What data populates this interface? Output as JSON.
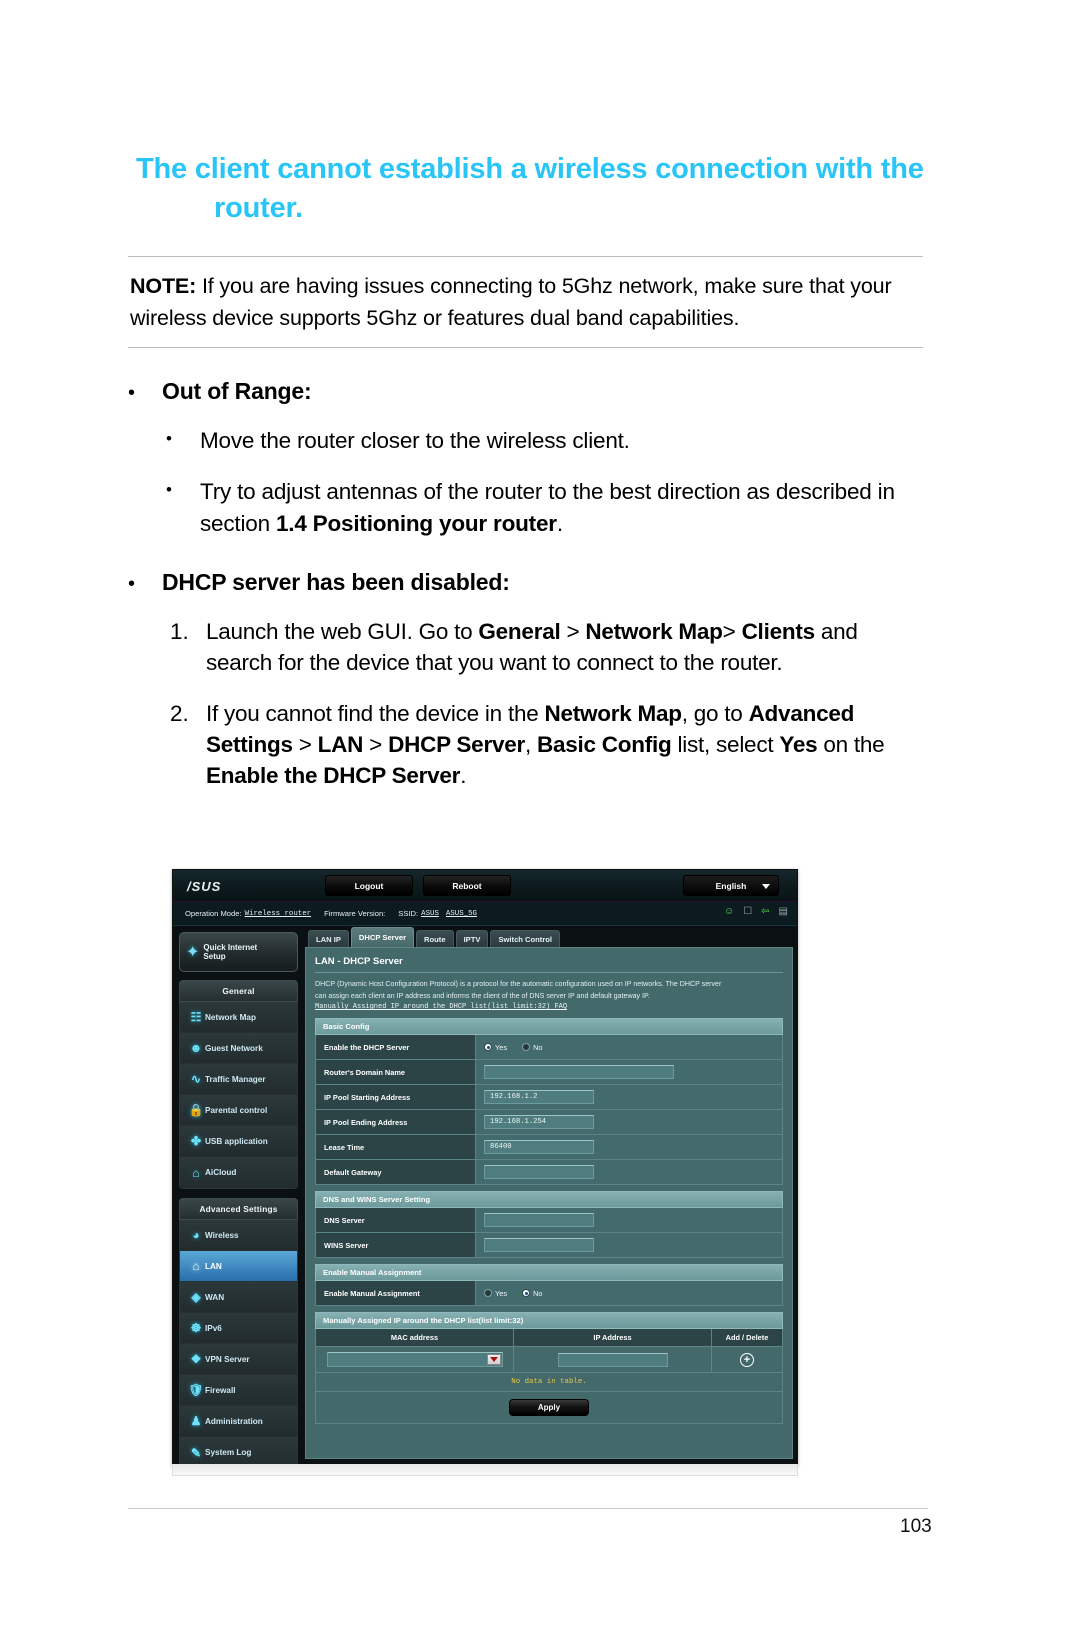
{
  "document": {
    "title_line1": "The client cannot establish a wireless connection with the",
    "title_line2": "router.",
    "note_label": "NOTE:",
    "note_text": " If you are having issues connecting to 5Ghz network, make sure that your wireless device supports 5Ghz or features dual band capabilities.",
    "bullets": [
      {
        "heading": "Out of Range:",
        "sub": [
          {
            "pre": "Move the router closer to the wireless client.",
            "bold": "",
            "post": ""
          },
          {
            "pre": "Try to adjust antennas of the router to the best direction as described in section ",
            "bold": "1.4 Positioning your router",
            "post": "."
          }
        ]
      },
      {
        "heading": "DHCP server has been disabled:",
        "steps": [
          {
            "num": "1.",
            "t1": "Launch the web GUI. Go to ",
            "b1": "General",
            "t2": " > ",
            "b2": "Network Map",
            "t3": ">",
            "b3": "Clients",
            "t4": " and search for the device that you want to connect to the router."
          },
          {
            "num": "2.",
            "t1": "If you cannot find the device in the ",
            "b1": "Network Map",
            "t2": ", go to ",
            "b2": "Advanced Settings",
            "t3": " > ",
            "b3": "LAN",
            "t4": " > ",
            "b4": "DHCP Server",
            "t5": ", ",
            "b5": "Basic Config",
            "t6": " list, select ",
            "b6": "Yes",
            "t7": " on the ",
            "b7": "Enable the DHCP Server",
            "t8": "."
          }
        ]
      }
    ],
    "page_number": "103"
  },
  "router_ui": {
    "brand": "/SUS",
    "topbar": {
      "logout": "Logout",
      "reboot": "Reboot",
      "language": "English"
    },
    "infobar": {
      "operation_mode_label": "Operation Mode:",
      "operation_mode_value": "Wireless router",
      "firmware_label": "Firmware Version:",
      "firmware_value": "",
      "ssid_label": "SSID:",
      "ssid_1": "ASUS",
      "ssid_2": "ASUS_5G",
      "icons": [
        "user-icon",
        "copy-icon",
        "usb-icon",
        "printer-icon"
      ]
    },
    "sidebar": {
      "quick_setup_line1": "Quick Internet",
      "quick_setup_line2": "Setup",
      "groups": [
        {
          "title": "General",
          "items": [
            {
              "label": "Network Map",
              "icon": "network-map-icon",
              "glyph": "⚙"
            },
            {
              "label": "Guest Network",
              "icon": "guest-network-icon",
              "glyph": "☻"
            },
            {
              "label": "Traffic Manager",
              "icon": "traffic-manager-icon",
              "glyph": "∿"
            },
            {
              "label": "Parental control",
              "icon": "parental-control-icon",
              "glyph": "⚿"
            },
            {
              "label": "USB application",
              "icon": "usb-application-icon",
              "glyph": "✤"
            },
            {
              "label": "AiCloud",
              "icon": "aicloud-icon",
              "glyph": "⌂"
            }
          ]
        },
        {
          "title": "Advanced Settings",
          "items": [
            {
              "label": "Wireless",
              "icon": "wireless-icon",
              "glyph": "◔"
            },
            {
              "label": "LAN",
              "icon": "lan-icon",
              "glyph": "⌂",
              "active": true
            },
            {
              "label": "WAN",
              "icon": "wan-icon",
              "glyph": "⊕"
            },
            {
              "label": "IPv6",
              "icon": "ipv6-icon",
              "glyph": "☸"
            },
            {
              "label": "VPN Server",
              "icon": "vpn-server-icon",
              "glyph": "⚒"
            },
            {
              "label": "Firewall",
              "icon": "firewall-icon",
              "glyph": "⛨"
            },
            {
              "label": "Administration",
              "icon": "administration-icon",
              "glyph": "♟"
            },
            {
              "label": "System Log",
              "icon": "system-log-icon",
              "glyph": "✎"
            }
          ]
        }
      ]
    },
    "tabs": [
      {
        "label": "LAN IP",
        "selected": false
      },
      {
        "label": "DHCP Server",
        "selected": true
      },
      {
        "label": "Route",
        "selected": false
      },
      {
        "label": "IPTV",
        "selected": false
      },
      {
        "label": "Switch Control",
        "selected": false
      }
    ],
    "panel": {
      "title": "LAN - DHCP Server",
      "desc_line1": "DHCP (Dynamic Host Configuration Protocol) is a protocol for the automatic configuration used on IP networks. The DHCP server",
      "desc_line2": "can assign each client an IP address and informs the client of the of DNS server IP and default gateway IP.",
      "faq_link": "Manually Assigned IP around the DHCP list(list limit:32) FAQ",
      "basic_config_header": "Basic Config",
      "fields": [
        {
          "label": "Enable the DHCP Server",
          "type": "radio",
          "yes": "Yes",
          "no": "No",
          "selected": "Yes"
        },
        {
          "label": "Router's Domain Name",
          "type": "text",
          "value": "",
          "width": "w190"
        },
        {
          "label": "IP Pool Starting Address",
          "type": "text",
          "value": "192.168.1.2",
          "width": "w110"
        },
        {
          "label": "IP Pool Ending Address",
          "type": "text",
          "value": "192.168.1.254",
          "width": "w110"
        },
        {
          "label": "Lease Time",
          "type": "text",
          "value": "86400",
          "width": "w110"
        },
        {
          "label": "Default Gateway",
          "type": "text",
          "value": "",
          "width": "w110"
        }
      ],
      "dns_header": "DNS and WINS Server Setting",
      "dns_fields": [
        {
          "label": "DNS Server",
          "type": "text",
          "value": "",
          "width": "w110"
        },
        {
          "label": "WINS Server",
          "type": "text",
          "value": "",
          "width": "w110"
        }
      ],
      "manual_header": "Enable Manual Assignment",
      "manual_field": {
        "label": "Enable Manual Assignment",
        "yes": "Yes",
        "no": "No",
        "selected": "No"
      },
      "list_header": "Manually Assigned IP around the DHCP list(list limit:32)",
      "table_columns": [
        "MAC address",
        "IP Address",
        "Add / Delete"
      ],
      "table_empty_message": "No data in table.",
      "apply_label": "Apply"
    }
  },
  "colors": {
    "heading_accent": "#29c5f6",
    "panel_bg": "#43696b",
    "panel_label_bg": "#2c4446",
    "active_menu": "#2a6fae",
    "warning_text": "#e7c84a"
  }
}
